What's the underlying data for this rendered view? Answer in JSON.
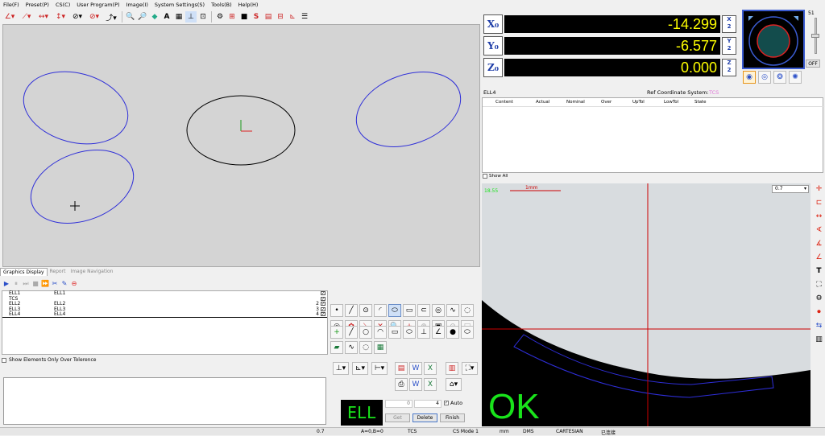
{
  "menu": [
    "File(F)",
    "Preset(P)",
    "CS(C)",
    "User Program(P)",
    "Image(I)",
    "System Settings(S)",
    "Tools(B)",
    "Help(H)"
  ],
  "tabs": [
    "Graphics Display",
    "Report",
    "Image Navigation"
  ],
  "elements": [
    {
      "name": "ELL1",
      "desc": "ELL1",
      "num": ""
    },
    {
      "name": "TCS",
      "desc": "",
      "num": ""
    },
    {
      "name": "ELL2",
      "desc": "ELL2",
      "num": "2"
    },
    {
      "name": "ELL3",
      "desc": "ELL3",
      "num": "3"
    },
    {
      "name": "ELL4",
      "desc": "ELL4",
      "num": "4"
    }
  ],
  "show_tolerance_label": "Show Elements Only Over Tolerence",
  "element_display": "ELL",
  "counter": {
    "left": "0",
    "right": "4",
    "auto_label": "Auto"
  },
  "buttons": {
    "get": "Get",
    "delete": "Delete",
    "finish": "Finish"
  },
  "ok_text": "OK",
  "dro": {
    "x_label": "X₀",
    "x_value": "-14.299",
    "y_label": "Y₀",
    "y_value": "-6.577",
    "z_label": "Z₀",
    "z_value": "0.000",
    "half_label": "X/2",
    "half_y": "Y/2",
    "half_z": "Z/2"
  },
  "minimap": {
    "slider_value": "51",
    "off_label": "OFF"
  },
  "result": {
    "element": "ELL4",
    "ref_label": "Ref Coordinate System:",
    "ref_value": "TCS",
    "columns": [
      "Content",
      "Actual",
      "Nominal",
      "Over",
      "UpTol",
      "LowTol",
      "State"
    ],
    "show_all": "Show All"
  },
  "camera": {
    "fps": "18.55",
    "scale": "1mm",
    "zoom": "0.7"
  },
  "status": {
    "zoom": "0.7",
    "ab": "A=0,B=0",
    "cs": "TCS",
    "mode": "CS Mode 1",
    "unit": "mm",
    "angle": "DMS",
    "coord": "CARTESIAN",
    "conn": "已连接"
  },
  "colors": {
    "ellipse": "#2e2ed8",
    "active_ellipse": "#000000",
    "dro_text": "#ffff00",
    "ok": "#19e31b",
    "crosshair": "#cc0000"
  }
}
